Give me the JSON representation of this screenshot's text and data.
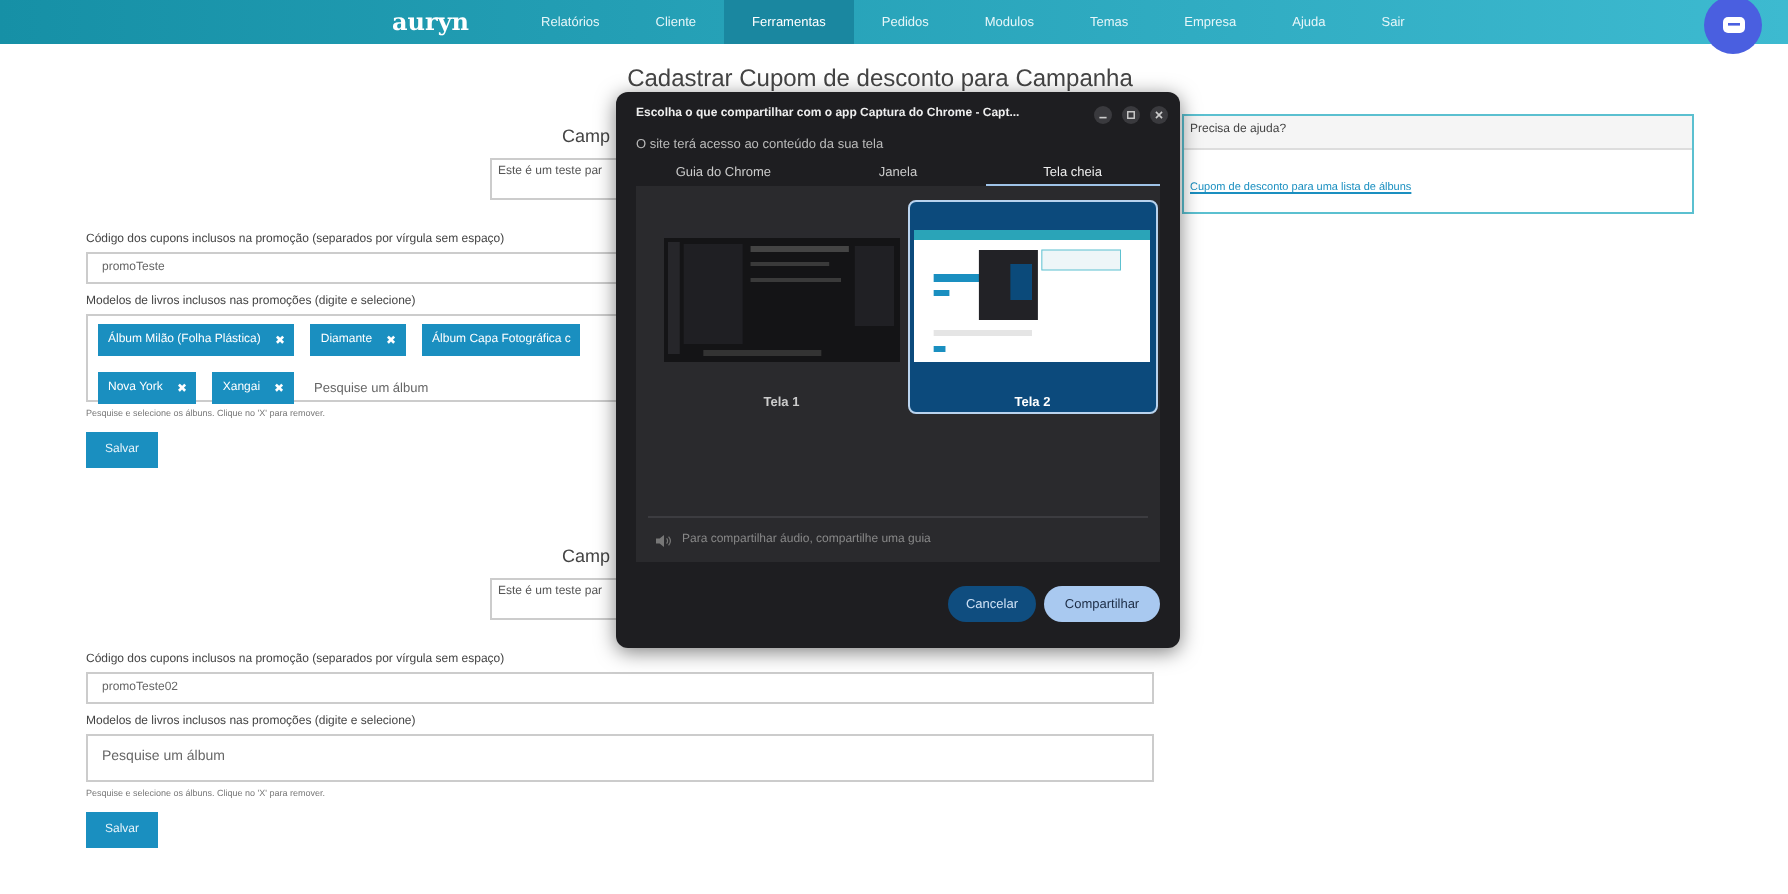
{
  "nav": {
    "brand": "auryn",
    "items": [
      {
        "label": "Relatórios",
        "selected": false
      },
      {
        "label": "Cliente",
        "selected": false
      },
      {
        "label": "Ferramentas",
        "selected": true
      },
      {
        "label": "Pedidos",
        "selected": false
      },
      {
        "label": "Modulos",
        "selected": false
      },
      {
        "label": "Temas",
        "selected": false
      },
      {
        "label": "Empresa",
        "selected": false
      },
      {
        "label": "Ajuda",
        "selected": false
      },
      {
        "label": "Sair",
        "selected": false
      }
    ]
  },
  "page_title": "Cadastrar Cupom de desconto para Campanha",
  "campaigns": [
    {
      "heading": "Camp",
      "description": "Este é um teste par",
      "codes_label": "Código dos cupons inclusos na promoção (separados por vírgula sem espaço)",
      "codes_value": "promoTeste",
      "models_label": "Modelos de livros inclusos nas promoções (digite e selecione)",
      "tags": [
        {
          "label": "Álbum Milão (Folha Plástica)",
          "remove": "✖"
        },
        {
          "label": "Diamante",
          "remove": "✖"
        },
        {
          "label": "Álbum Capa Fotográfica c"
        },
        {
          "label": "Nova York",
          "remove": "✖"
        },
        {
          "label": "Xangai",
          "remove": "✖"
        }
      ],
      "search_placeholder": "Pesquise um álbum",
      "hint": "Pesquise e selecione os álbuns. Clique no 'X' para remover.",
      "save_button": "Salvar"
    },
    {
      "heading": "Camp",
      "description": "Este é um teste par",
      "codes_label": "Código dos cupons inclusos na promoção (separados por vírgula sem espaço)",
      "codes_value": "promoTeste02",
      "models_label": "Modelos de livros inclusos nas promoções (digite e selecione)",
      "search_placeholder": "Pesquise um álbum",
      "hint": "Pesquise e selecione os álbuns. Clique no 'X' para remover.",
      "save_button": "Salvar"
    }
  ],
  "help": {
    "title": "Precisa de ajuda?",
    "link": "Cupom de desconto para uma lista de álbuns"
  },
  "dialog": {
    "title": "Escolha o que compartilhar com o app Captura do Chrome - Capt...",
    "subtitle": "O site terá acesso ao conteúdo da sua tela",
    "tabs": [
      {
        "label": "Guia do Chrome",
        "selected": false
      },
      {
        "label": "Janela",
        "selected": false
      },
      {
        "label": "Tela cheia",
        "selected": true
      }
    ],
    "screens": [
      {
        "label": "Tela 1",
        "selected": false,
        "kind": "dark"
      },
      {
        "label": "Tela 2",
        "selected": true,
        "kind": "light"
      }
    ],
    "audio_note": "Para compartilhar áudio, compartilhe uma guia",
    "cancel_button": "Cancelar",
    "share_button": "Compartilhar"
  }
}
